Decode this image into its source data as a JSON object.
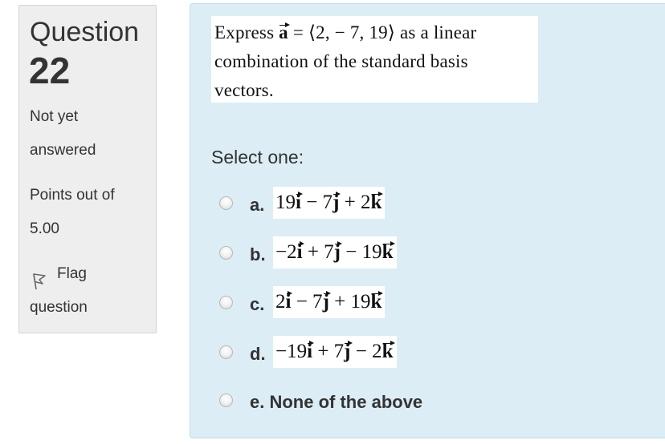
{
  "info": {
    "title": "Question",
    "number": "22",
    "state_line1": "Not yet",
    "state_line2": "answered",
    "grade_line1": "Points out of",
    "grade_line2": "5.00",
    "flag_line1": "Flag",
    "flag_line2": "question",
    "flag_icon": "flag-icon"
  },
  "question": {
    "prefix": "Express ",
    "vector": "a",
    "equals_value": " = ⟨2, − 7, 19⟩ as a linear",
    "line2": "combination of the standard basis",
    "line3": "vectors."
  },
  "prompt": "Select one:",
  "options": [
    {
      "letter": "a.",
      "terms": [
        {
          "coef": "19",
          "unit": "i"
        },
        {
          "coef": " − 7",
          "unit": "j"
        },
        {
          "coef": " + 2",
          "unit": "k"
        }
      ]
    },
    {
      "letter": "b.",
      "terms": [
        {
          "coef": "−2",
          "unit": "i"
        },
        {
          "coef": " + 7",
          "unit": "j"
        },
        {
          "coef": " − 19",
          "unit": "k"
        }
      ]
    },
    {
      "letter": "c.",
      "terms": [
        {
          "coef": "2",
          "unit": "i"
        },
        {
          "coef": " − 7",
          "unit": "j"
        },
        {
          "coef": " + 19",
          "unit": "k"
        }
      ]
    },
    {
      "letter": "d.",
      "terms": [
        {
          "coef": "−19",
          "unit": "i"
        },
        {
          "coef": " + 7",
          "unit": "j"
        },
        {
          "coef": " − 2",
          "unit": "k"
        }
      ]
    },
    {
      "letter": "e.",
      "text": "None of the above"
    }
  ],
  "colors": {
    "info_bg": "#eeeeee",
    "content_bg": "#dcedf5",
    "text": "#333333"
  }
}
